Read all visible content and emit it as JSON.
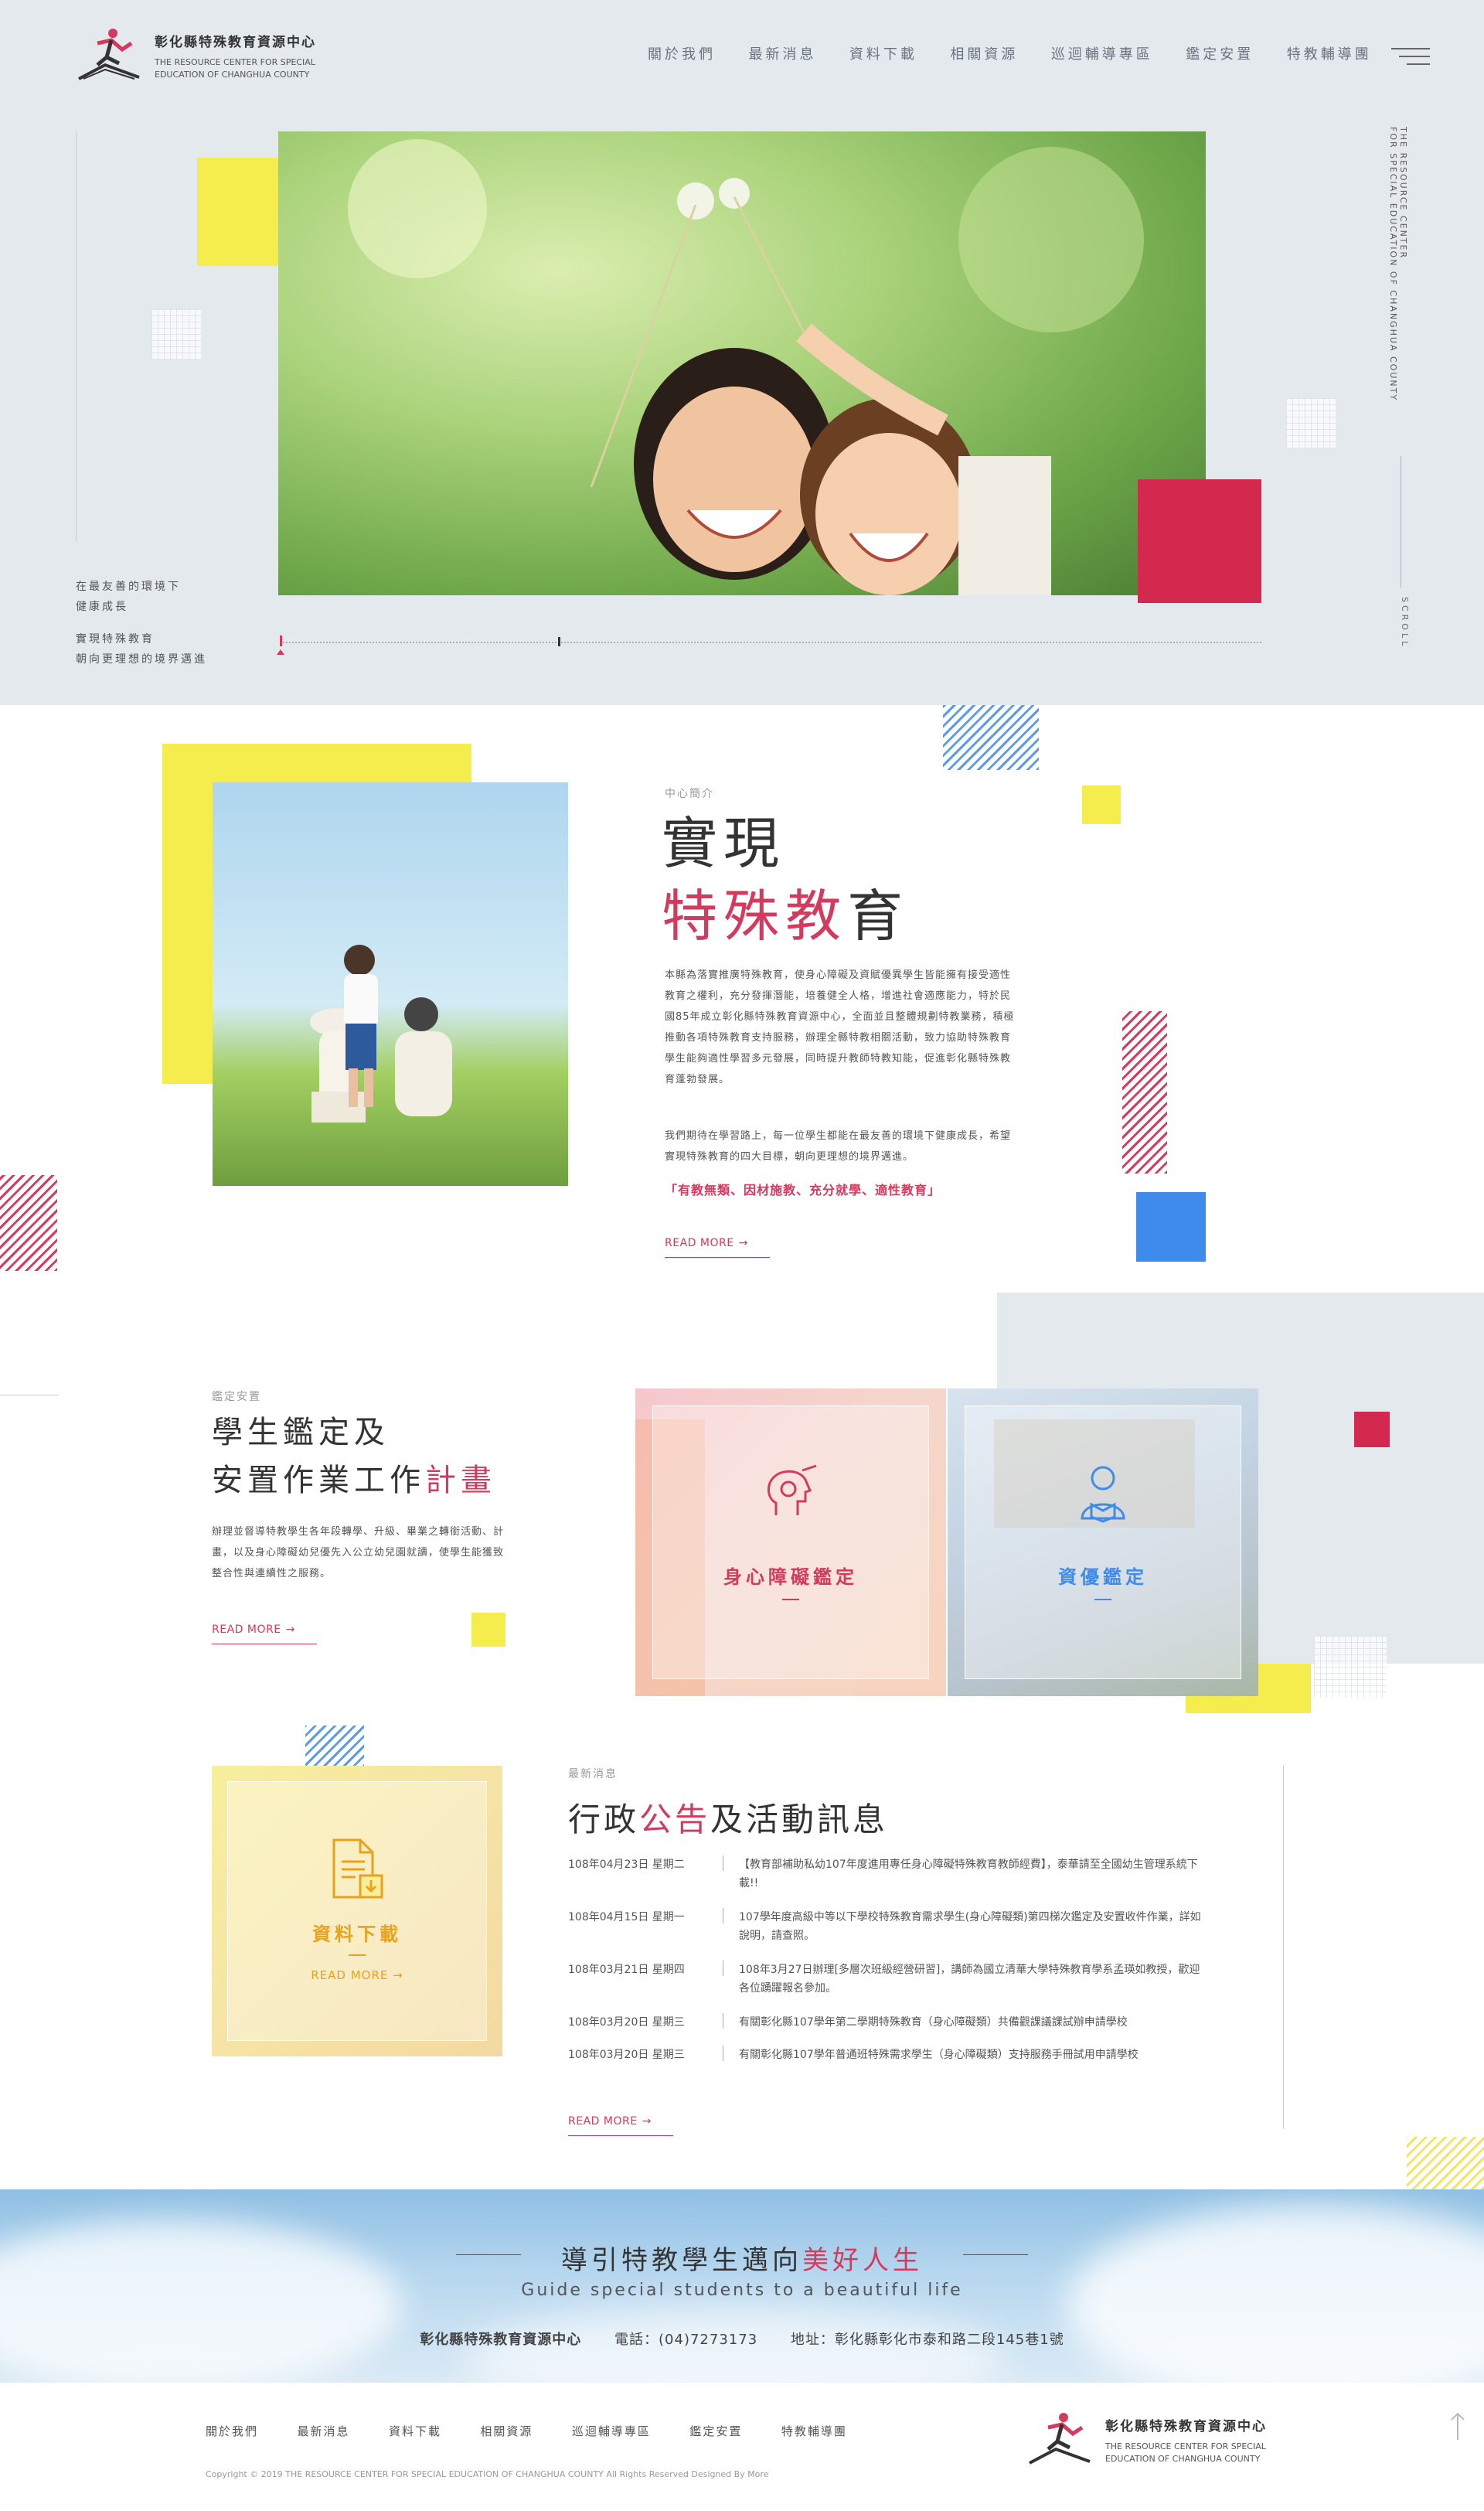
{
  "brand": {
    "name": "彰化縣特殊教育資源中心",
    "en_line1": "THE RESOURCE CENTER FOR SPECIAL",
    "en_line2": "EDUCATION OF CHANGHUA COUNTY"
  },
  "nav": [
    "關於我們",
    "最新消息",
    "資料下載",
    "相關資源",
    "巡迴輔導專區",
    "鑑定安置",
    "特教輔導團"
  ],
  "hero": {
    "side_en_1": "THE RESOURCE CENTER",
    "side_en_2": "FOR SPECIAL EDUCATION OF CHANGHUA COUNTY",
    "scroll": "SCROLL",
    "caption1_a": "在最友善的環境下",
    "caption1_b": "健康成長",
    "caption2_a": "實現特殊教育",
    "caption2_b": "朝向更理想的境界邁進"
  },
  "about": {
    "kicker": "中心簡介",
    "title_1": "實現",
    "title_2a": "特殊",
    "title_2b": "教",
    "title_2c": "育",
    "p1": "本縣為落實推廣特殊教育，使身心障礙及資賦優異學生皆能擁有接受適性教育之權利，充分發揮潛能，培養健全人格，增進社會適應能力，特於民國85年成立彰化縣特殊教育資源中心，全面並且整體規劃特教業務，積極推動各項特殊教育支持服務，辦理全縣特教相關活動，致力協助特殊教育學生能夠適性學習多元發展，同時提升教師特教知能，促進彰化縣特殊教育蓬勃發展。",
    "p2": "我們期待在學習路上，每一位學生都能在最友善的環境下健康成長，希望實現特殊教育的四大目標，朝向更理想的境界邁進。",
    "quote": "「有教無類、因材施教、充分就學、適性教育」",
    "readmore": "READ MORE"
  },
  "assess": {
    "kicker": "鑑定安置",
    "title_1": "學生鑑定及",
    "title_2a": "安置作業工作",
    "title_2b": "計畫",
    "desc": "辦理並督導特教學生各年段轉學、升級、畢業之轉銜活動、計畫，以及身心障礙幼兒優先入公立幼兒園就讀，使學生能獲致整合性與連續性之服務。",
    "readmore": "READ MORE",
    "card1": "身心障礙鑑定",
    "card2": "資優鑑定"
  },
  "download": {
    "label": "資料下載",
    "readmore": "READ MORE"
  },
  "news": {
    "kicker": "最新消息",
    "title_a": "行政",
    "title_b": "公告",
    "title_c": "及活動訊息",
    "readmore": "READ MORE",
    "items": [
      {
        "date": "108年04月23日 星期二",
        "text": "【教育部補助私幼107年度進用專任身心障礙特殊教育教師經費】，泰華請至全國幼生管理系統下載!!",
        "text2": ""
      },
      {
        "date": "108年04月15日 星期一",
        "text": "107學年度高級中等以下學校特殊教育需求學生(身心障礙類)第四梯次鑑定及安置收件作業，詳如說明，請查照。",
        "text2": ""
      },
      {
        "date": "108年03月21日 星期四",
        "text": "108年3月27日辦理[多層次班級經營研習]，講師為國立清華大學特殊教育學系孟瑛如教授，歡迎各位踴躍報名參加。",
        "text2": ""
      },
      {
        "date": "108年03月20日 星期三",
        "text": "有關彰化縣107學年第二學期特殊教育（身心障礙類）共備觀課議課試辦申請學校",
        "text2": ""
      },
      {
        "date": "108年03月20日 星期三",
        "text": "有關彰化縣107學年普通班特殊需求學生（身心障礙類）支持服務手冊試用申請學校",
        "text2": ""
      }
    ]
  },
  "banner": {
    "title_a": "導引特教學生邁向",
    "title_b": "美好人生",
    "subtitle": "Guide special students to a beautiful life",
    "org": "彰化縣特殊教育資源中心",
    "phone": "電話：(04)7273173",
    "address": "地址：彰化縣彰化市泰和路二段145巷1號"
  },
  "footer": {
    "nav": [
      "關於我們",
      "最新消息",
      "資料下載",
      "相關資源",
      "巡迴輔導專區",
      "鑑定安置",
      "特教輔導團"
    ],
    "copyright": "Copyright © 2019 THE RESOURCE CENTER FOR SPECIAL EDUCATION OF CHANGHUA COUNTY All Rights Reserved Designed By More"
  },
  "colors": {
    "accent": "#d43a5e",
    "yellow": "#f5ec4e",
    "blue": "#3f8bec",
    "hero_bg": "#e4e9ee"
  }
}
